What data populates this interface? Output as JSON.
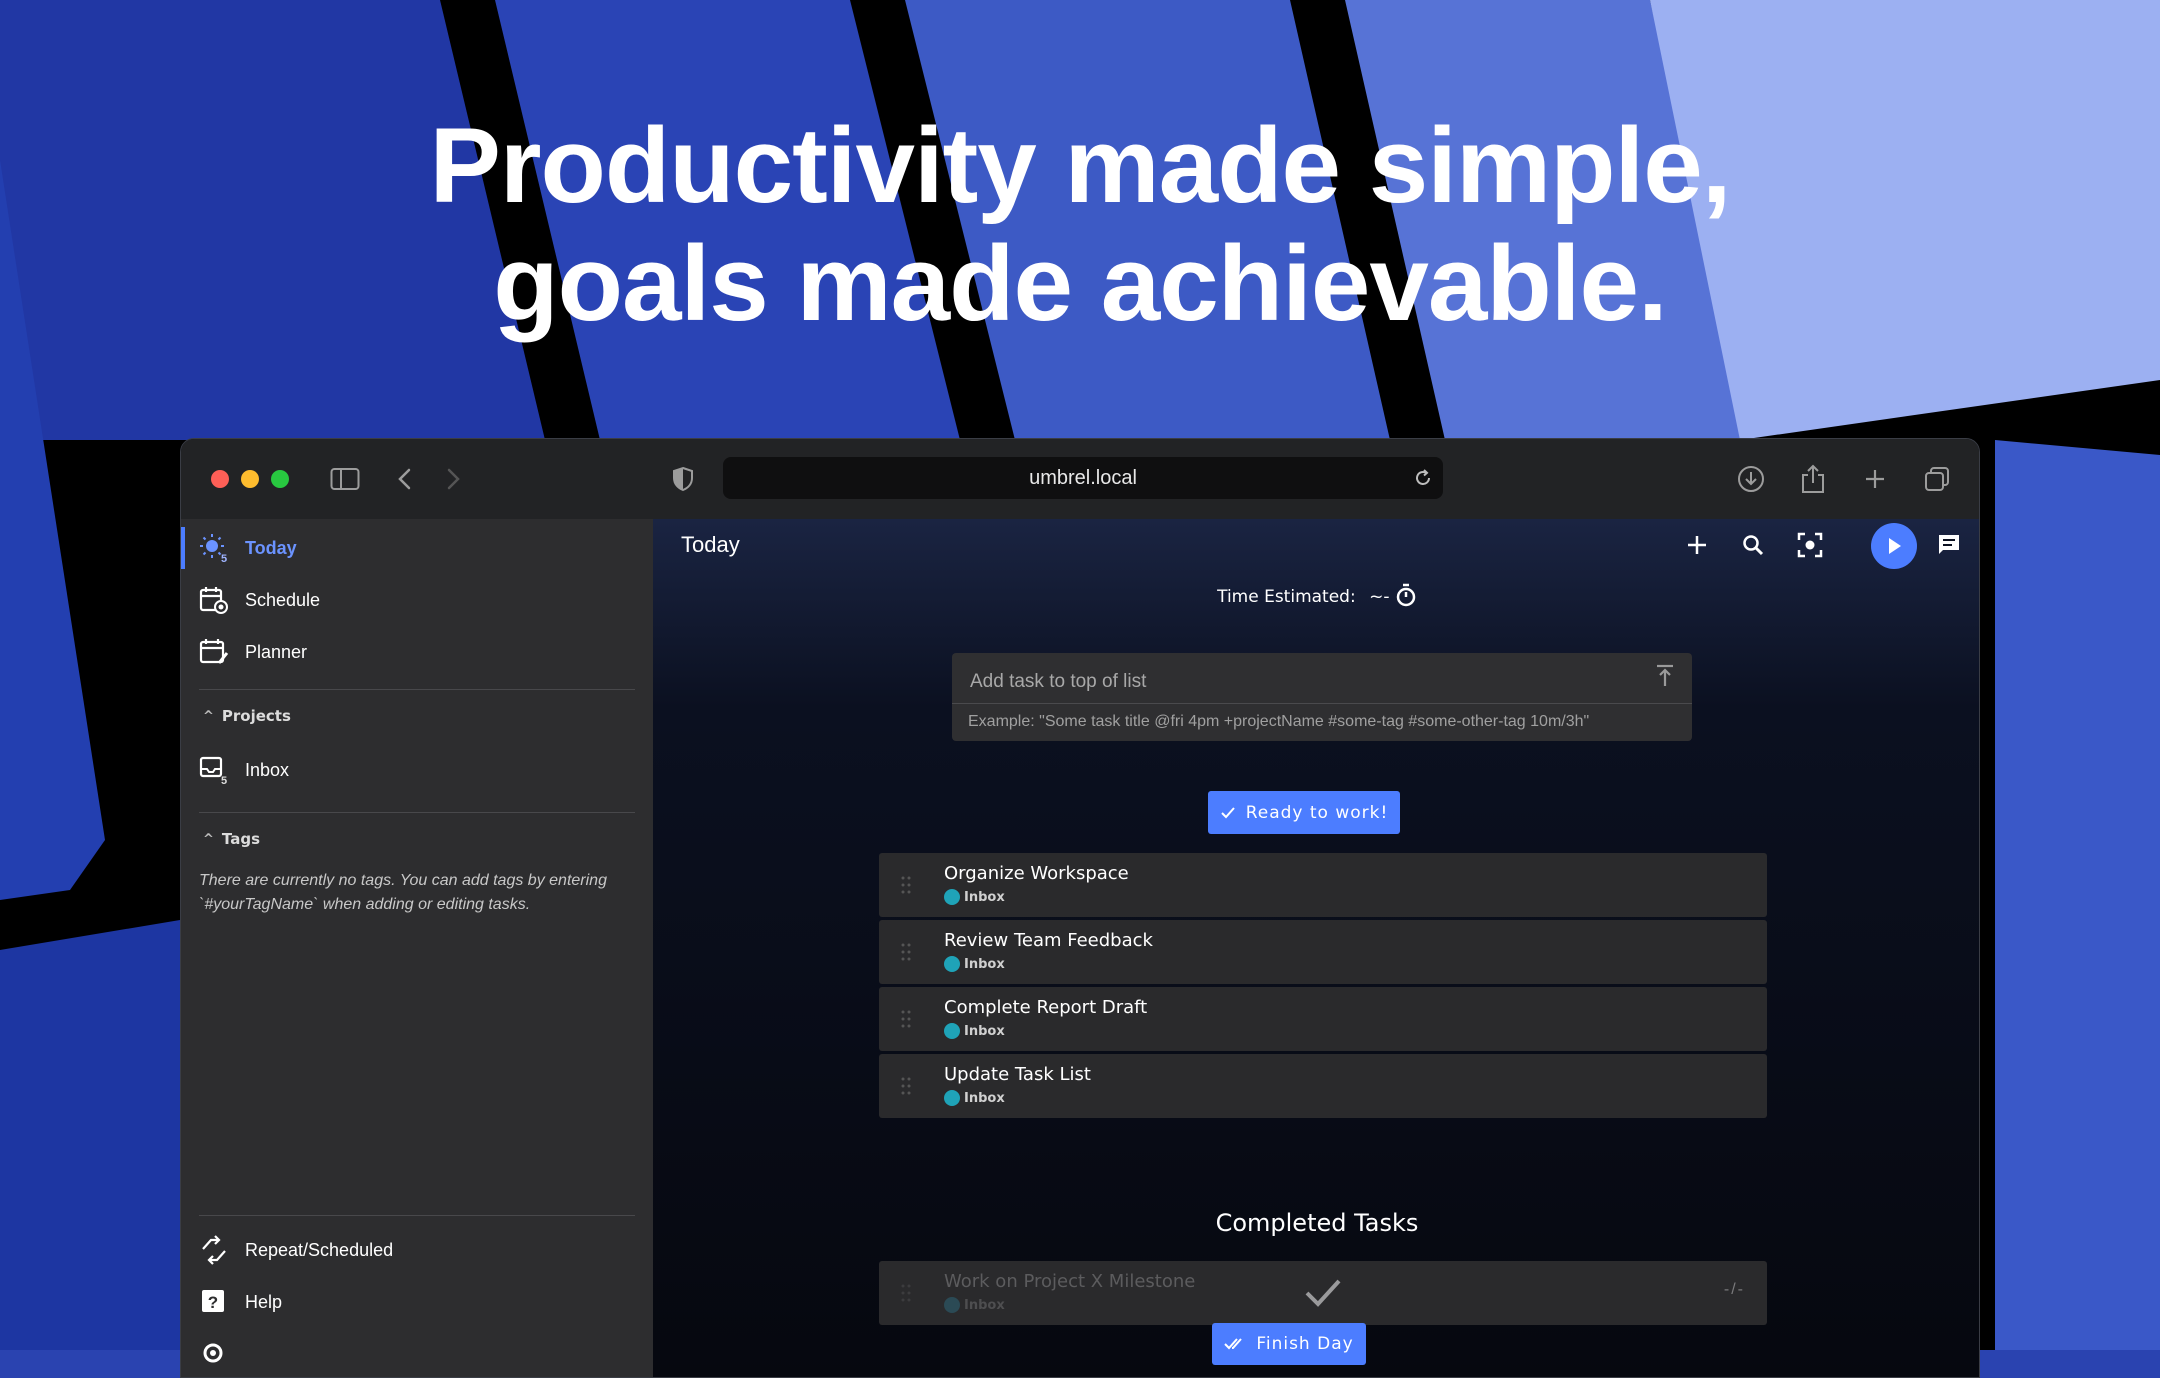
{
  "headline": {
    "line1": "Productivity made simple,",
    "line2": "goals made achievable."
  },
  "browser": {
    "url": "umbrel.local"
  },
  "sidebar": {
    "items": [
      {
        "label": "Today",
        "badge": "5"
      },
      {
        "label": "Schedule"
      },
      {
        "label": "Planner"
      }
    ],
    "projects_heading": "Projects",
    "projects": [
      {
        "label": "Inbox",
        "badge": "5"
      }
    ],
    "tags_heading": "Tags",
    "tags_empty": "There are currently no tags. You can add tags by entering `#yourTagName` when adding or editing tasks.",
    "bottom_items": [
      {
        "label": "Repeat/Scheduled"
      },
      {
        "label": "Help"
      }
    ]
  },
  "main": {
    "title": "Today",
    "time_estimated_label": "Time Estimated:",
    "time_estimated_value": "~-",
    "add_task": {
      "placeholder": "Add task to top of list",
      "hint": "Example: \"Some task title @fri 4pm +projectName #some-tag #some-other-tag 10m/3h\""
    },
    "ready_button": "Ready to work!",
    "tasks": [
      {
        "title": "Organize Workspace",
        "project": "Inbox"
      },
      {
        "title": "Review Team Feedback",
        "project": "Inbox"
      },
      {
        "title": "Complete Report Draft",
        "project": "Inbox"
      },
      {
        "title": "Update Task List",
        "project": "Inbox"
      }
    ],
    "completed_heading": "Completed Tasks",
    "completed_tasks": [
      {
        "title": "Work on Project X Milestone",
        "project": "Inbox",
        "time": "-/-"
      }
    ],
    "finish_button": "Finish Day"
  },
  "colors": {
    "accent": "#4c7dff",
    "project_icon": "#1fa3b8",
    "sidebar_bg": "#2d2d2f",
    "headline_bg": "#2a43b0"
  }
}
